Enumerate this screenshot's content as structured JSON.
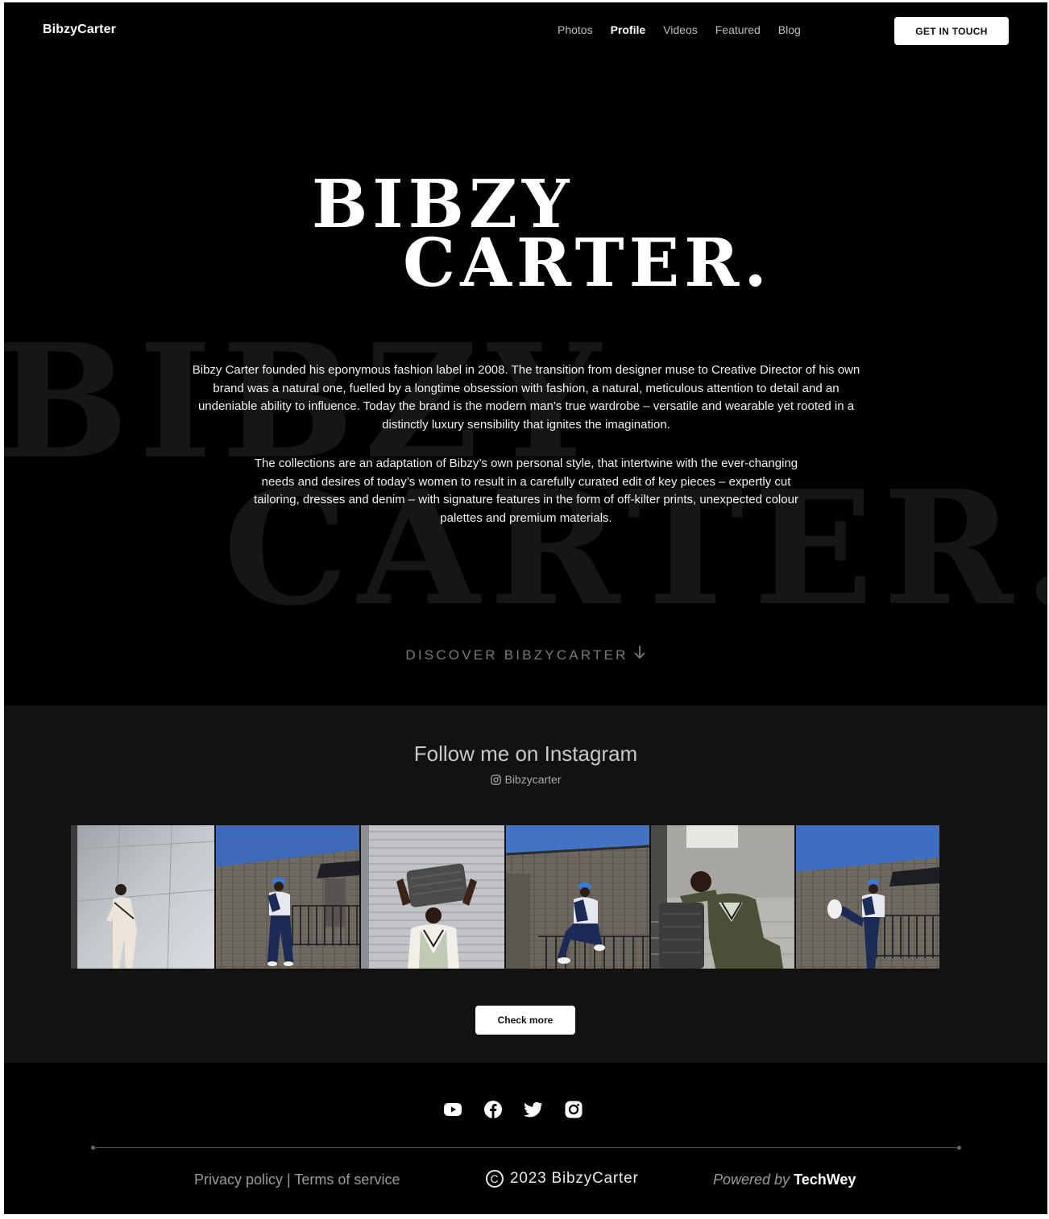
{
  "header": {
    "logo": "BibzyCarter",
    "nav": [
      "Photos",
      "Profile",
      "Videos",
      "Featured",
      "Blog"
    ],
    "active_nav": "Profile",
    "cta_label": "GET IN TOUCH"
  },
  "hero": {
    "title_line1": "BIBZY",
    "title_line2": "CARTER.",
    "ghost_line1": "BIBZY",
    "ghost_line2": "CARTER.",
    "paragraph1": "Bibzy Carter founded his eponymous fashion label in 2008. The transition from designer muse to Creative Director of his own brand was a natural one, fuelled by a longtime obsession with fashion, a natural, meticulous attention to detail and an undeniable ability to influence. Today the brand is the modern man’s true wardrobe – versatile and wearable yet rooted in a distinctly luxury sensibility that ignites the imagination.",
    "paragraph2": "The collections are an adaptation of Bibzy’s own personal style, that intertwine with the ever-changing needs and desires of today’s women to result in a carefully curated edit of key pieces – expertly cut tailoring, dresses and denim – with signature features in the form of off-kilter prints, unexpected colour palettes and premium materials.",
    "discover_label": "DISCOVER BIBZYCARTER",
    "discover_icon": "arrow-down-icon"
  },
  "instagram": {
    "title": "Follow me on Instagram",
    "handle": "Bibzycarter",
    "handle_icon": "instagram-icon",
    "photos": [
      {
        "scene": "white-wall-cream-outfit"
      },
      {
        "scene": "brick-wall-blue-cap"
      },
      {
        "scene": "garage-door-suitcase-on-head"
      },
      {
        "scene": "brick-wall-sitting-railing"
      },
      {
        "scene": "sitting-with-suitcase"
      },
      {
        "scene": "brick-wall-leg-kick"
      }
    ],
    "check_more_label": "Check more"
  },
  "footer": {
    "socials": [
      "youtube-icon",
      "facebook-icon",
      "twitter-icon",
      "instagram-icon"
    ],
    "privacy": "Privacy policy",
    "separator": "|",
    "terms": "Terms of service",
    "copyright_symbol": "C",
    "copyright": "2023 BibzyCarter",
    "powered_prefix": "Powered by",
    "powered_brand": "TechWey"
  },
  "colors": {
    "background": "#000000",
    "section_bg": "#121212",
    "accent_blue": "#3f6fd0",
    "text": "#ffffff"
  }
}
